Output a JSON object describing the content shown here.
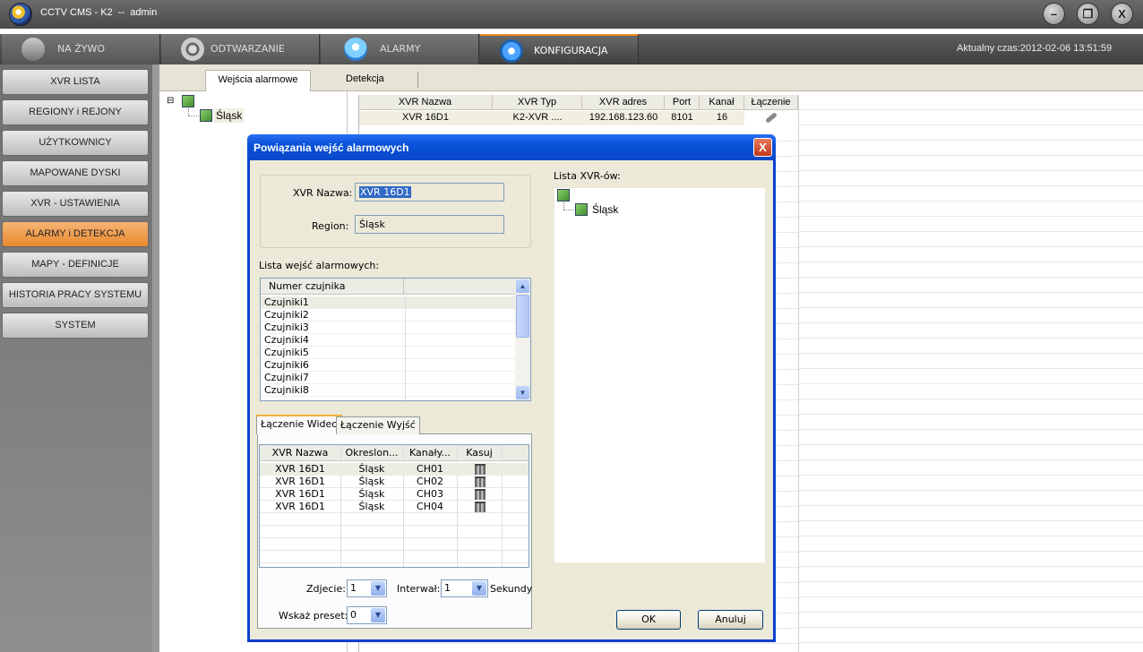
{
  "window": {
    "title": "CCTV CMS - K2  --  admin",
    "minimize": "–",
    "restore": "❐",
    "close": "X"
  },
  "main_tabs": [
    {
      "label": "NA ŻYWO",
      "icon": "camera-icon"
    },
    {
      "label": "ODTWARZANIE",
      "icon": "film-reel-icon"
    },
    {
      "label": "ALARMY",
      "icon": "alarm-siren-icon"
    },
    {
      "label": "KONFIGURACJA",
      "icon": "gear-icon"
    }
  ],
  "clock": "Aktualny czas:2012-02-06 13:51:59",
  "left_nav": [
    "XVR LISTA",
    "REGIONY i REJONY",
    "UŻYTKOWNICY",
    "MAPOWANE DYSKI",
    "XVR - USTAWIENIA",
    "ALARMY i DETEKCJA",
    "MAPY - DEFINICJE",
    "HISTORIA PRACY SYSTEMU",
    "SYSTEM"
  ],
  "left_nav_active": "ALARMY i DETEKCJA",
  "sub_tabs": [
    "Wejścia alarmowe",
    "Detekcja"
  ],
  "tree": {
    "root_toggle": "⊟",
    "child": "Śląsk"
  },
  "grid": {
    "headers": [
      "XVR Nazwa",
      "XVR Typ",
      "XVR adres",
      "Port",
      "Kanał",
      "Łączenie"
    ],
    "rows": [
      [
        "XVR 16D1",
        "K2-XVR ....",
        "192.168.123.60",
        "8101",
        "16",
        ""
      ]
    ]
  },
  "dialog": {
    "title": "Powiązania wejść alarmowych",
    "close": "X",
    "xvr_name_label": "XVR Nazwa:",
    "xvr_name_value": "XVR 16D1",
    "region_label": "Region:",
    "region_value": "Śląsk",
    "alarm_inputs_label": "Lista wejść alarmowych:",
    "alarm_inputs_header": "Numer czujnika",
    "alarm_inputs": [
      "Czujniki1",
      "Czujniki2",
      "Czujniki3",
      "Czujniki4",
      "Czujniki5",
      "Czujniki6",
      "Czujniki7",
      "Czujniki8"
    ],
    "link_tabs": [
      "Łączenie Wideo",
      "Łączenie Wyjść"
    ],
    "link_headers": [
      "XVR Nazwa",
      "Okreslon...",
      "Kanały...",
      "Kasuj"
    ],
    "link_rows": [
      [
        "XVR 16D1",
        "Śląsk",
        "CH01"
      ],
      [
        "XVR 16D1",
        "Śląsk",
        "CH02"
      ],
      [
        "XVR 16D1",
        "Śląsk",
        "CH03"
      ],
      [
        "XVR 16D1",
        "Śląsk",
        "CH04"
      ]
    ],
    "photo_label": "Zdjecie:",
    "photo_value": "1",
    "interval_label": "Interwał:",
    "interval_value": "1",
    "seconds_label": "Sekundy",
    "preset_label": "Wskaż preset:",
    "preset_value": "0",
    "xvr_list_label": "Lista XVR-ów:",
    "xvr_tree_child": "Śląsk",
    "ok": "OK",
    "cancel": "Anuluj"
  },
  "colors": {
    "accent": "#f08a24",
    "dialog_title": "#0a49c8",
    "nav_active": "#e98a2e"
  }
}
